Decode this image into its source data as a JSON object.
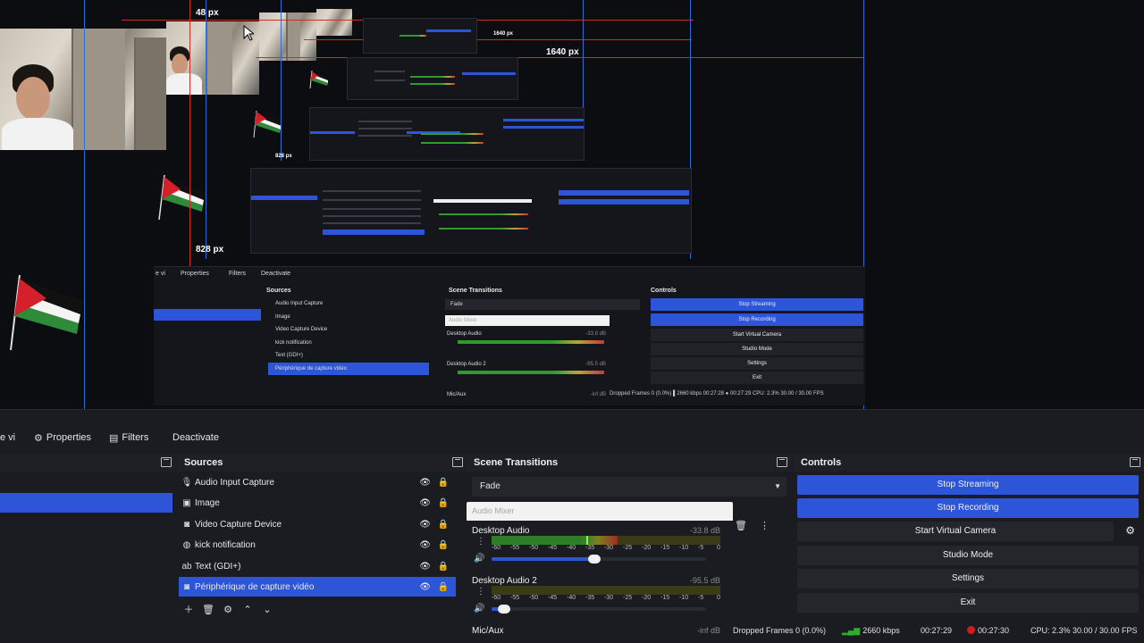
{
  "preview": {
    "labels": {
      "top_px": "48 px",
      "width_small": "1640 px",
      "width_large": "1640 px",
      "height_small": "828 px",
      "height_large": "828 px"
    },
    "nested": {
      "tabs": [
        "e vi",
        "Properties",
        "Filters",
        "Deactivate"
      ],
      "sources_title": "Sources",
      "transitions_title": "Scene Transitions",
      "controls_title": "Controls",
      "sources": [
        "Audio Input Capture",
        "Image",
        "Video Capture Device",
        "kick notification",
        "Text (GDI+)",
        "Périphérique de capture vidéo"
      ],
      "transition": "Fade",
      "mixer_title": "Audio Mixer",
      "channels": [
        {
          "name": "Desktop Audio",
          "db": "-33.8 dB"
        },
        {
          "name": "Desktop Audio 2",
          "db": "-95.5 dB"
        },
        {
          "name": "Mic/Aux",
          "db": "-inf dB"
        }
      ],
      "controls": [
        "Stop Streaming",
        "Stop Recording",
        "Start Virtual Camera",
        "Studio Mode",
        "Settings",
        "Exit"
      ],
      "status": "Dropped Frames 0 (0.0%)   ▌2660 kbps   00:27:28   ● 00:27:29   CPU: 2.3%   30.00 / 30.00 FPS"
    }
  },
  "toolbar": {
    "cut_label": "e vi",
    "properties": "Properties",
    "filters": "Filters",
    "deactivate": "Deactivate"
  },
  "sources": {
    "title": "Sources",
    "items": [
      {
        "label": "Audio Input Capture",
        "icon": "microphone-icon"
      },
      {
        "label": "Image",
        "icon": "image-icon"
      },
      {
        "label": "Video Capture Device",
        "icon": "camera-icon"
      },
      {
        "label": "kick notification",
        "icon": "browser-icon"
      },
      {
        "label": "Text (GDI+)",
        "icon": "text-icon"
      },
      {
        "label": "Périphérique de capture vidéo",
        "icon": "camera-icon",
        "selected": true
      }
    ]
  },
  "transitions": {
    "title": "Scene Transitions",
    "selected": "Fade"
  },
  "mixer": {
    "title": "Audio Mixer",
    "channels": [
      {
        "name": "Desktop Audio",
        "db": "-33.8 dB",
        "level": 0.55,
        "volume": 0.48
      },
      {
        "name": "Desktop Audio 2",
        "db": "-95.5 dB",
        "level": 0.0,
        "volume": 0.06
      },
      {
        "name": "Mic/Aux",
        "db": "-inf dB",
        "level": 0.0,
        "volume": 0.0
      }
    ],
    "ticks": [
      "-60",
      "-55",
      "-50",
      "-45",
      "-40",
      "-35",
      "-30",
      "-25",
      "-20",
      "-15",
      "-10",
      "-5",
      "0"
    ]
  },
  "controls": {
    "title": "Controls",
    "stop_streaming": "Stop Streaming",
    "stop_recording": "Stop Recording",
    "start_virtual_camera": "Start Virtual Camera",
    "studio_mode": "Studio Mode",
    "settings": "Settings",
    "exit": "Exit"
  },
  "status": {
    "dropped_frames": "Dropped Frames 0 (0.0%)",
    "bitrate": "2660 kbps",
    "stream_time": "00:27:29",
    "rec_time": "00:27:30",
    "cpu": "CPU: 2.3%",
    "fps": "30.00 / 30.00 FPS"
  },
  "colors": {
    "accent": "#2d55d8",
    "guide_blue": "#2a6fd8",
    "guide_red": "#d42a2a",
    "rec_red": "#d11c1c",
    "signal_green": "#27b327"
  }
}
